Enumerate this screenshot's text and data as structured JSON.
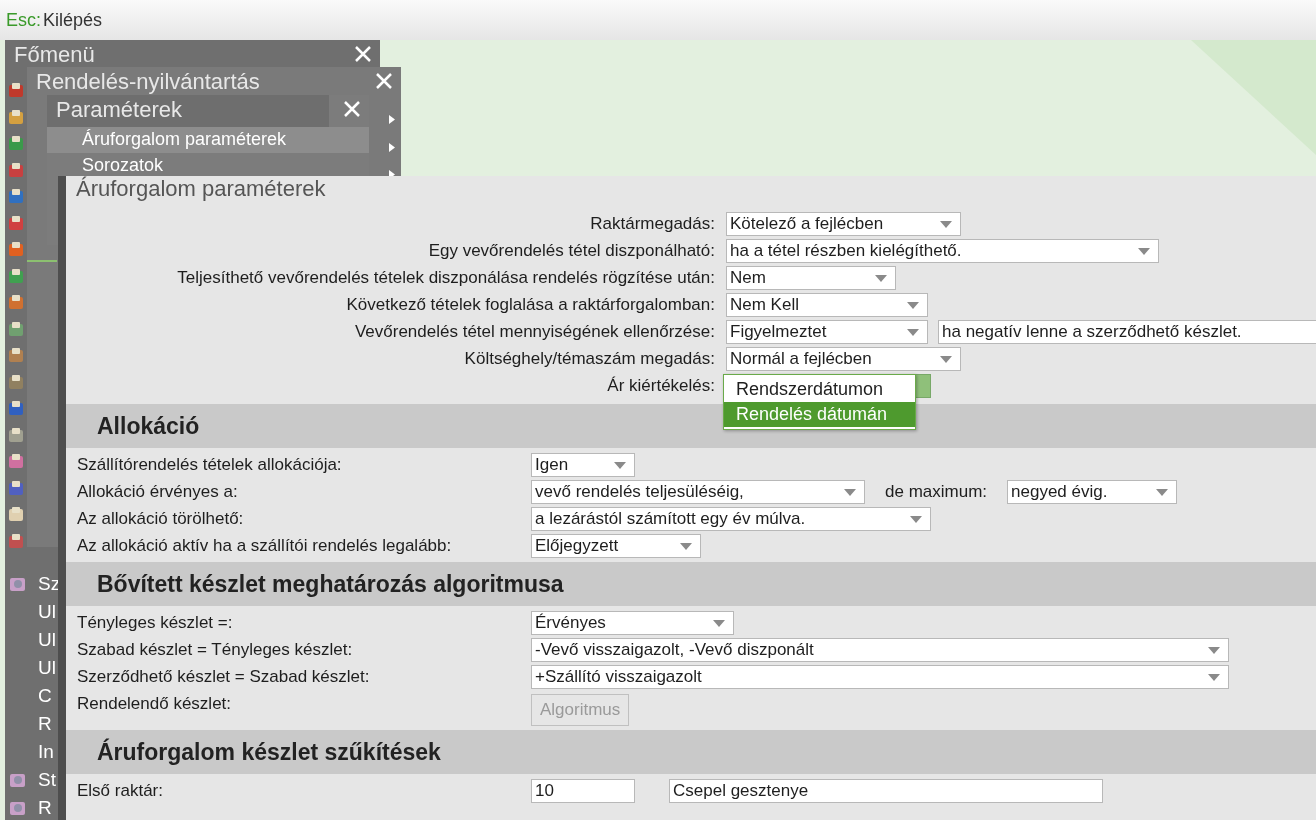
{
  "top_bar": {
    "key": "Esc:",
    "label": "Kilépés"
  },
  "main_menu": {
    "title": "Főmenü",
    "items": [
      {
        "label": "Sz",
        "kind": "icon"
      },
      {
        "label": "Ul",
        "kind": "text"
      },
      {
        "label": "Ul",
        "kind": "text"
      },
      {
        "label": "Ul",
        "kind": "text"
      },
      {
        "label": "C",
        "kind": "text"
      },
      {
        "label": "R",
        "kind": "text"
      },
      {
        "label": "In",
        "kind": "text"
      },
      {
        "label": "St",
        "kind": "icon"
      },
      {
        "label": "R",
        "kind": "icon"
      }
    ]
  },
  "order_window": {
    "title": "Rendelés-nyilvántartás"
  },
  "params_window": {
    "title": "Paraméterek",
    "items": [
      {
        "label": "Áruforgalom paraméterek",
        "selected": true
      },
      {
        "label": "Sorozatok",
        "selected": false
      }
    ]
  },
  "dialog": {
    "title": "Áruforgalom paraméterek",
    "top_rows": [
      {
        "label": "Raktármegadás:",
        "kind": "select",
        "value": "Kötelező a fejlécben"
      },
      {
        "label": "Egy vevőrendelés tétel diszponálható:",
        "kind": "select",
        "value": "ha a tétel részben kielégíthető."
      },
      {
        "label": "Teljesíthető vevőrendelés tételek diszponálása rendelés rögzítése után:",
        "kind": "select",
        "value": "Nem"
      },
      {
        "label": "Következő tételek foglalása a raktárforgalomban:",
        "kind": "select",
        "value": "Nem Kell"
      },
      {
        "label": "Vevőrendelés tétel mennyiségének ellenőrzése:",
        "kind": "select",
        "value": "Figyelmeztet",
        "extra": "ha negatív lenne a szerződhető készlet."
      },
      {
        "label": "Költséghely/témaszám megadás:",
        "kind": "select",
        "value": "Normál a fejlécben"
      },
      {
        "label": "Ár kiértékelés:",
        "kind": "open_select",
        "options": [
          {
            "label": "Rendszerdátumon",
            "selected": false
          },
          {
            "label": "Rendelés dátumán",
            "selected": true
          }
        ]
      }
    ],
    "sections": [
      {
        "title": "Allokáció",
        "rows": [
          {
            "label": "Szállítórendelés tételek allokációja:",
            "kind": "select",
            "value": "Igen"
          },
          {
            "label": "Allokáció érvényes a:",
            "kind": "select",
            "value": "vevő rendelés teljesüléséig,",
            "extra_label": "de maximum:",
            "extra_value": "negyed évig."
          },
          {
            "label": "Az allokáció törölhető:",
            "kind": "select",
            "value": "a lezárástól számított egy év múlva."
          },
          {
            "label": "Az allokáció aktív ha a szállítói rendelés legalább:",
            "kind": "select",
            "value": "Előjegyzett"
          }
        ]
      },
      {
        "title": "Bővített készlet meghatározás algoritmusa",
        "rows": [
          {
            "label": "Tényleges készlet =:",
            "kind": "select",
            "value": "Érvényes"
          },
          {
            "label": "Szabad készlet = Tényleges készlet:",
            "kind": "select",
            "value": "-Vevő visszaigazolt, -Vevő diszponált"
          },
          {
            "label": "Szerződhető készlet = Szabad készlet:",
            "kind": "select",
            "value": "+Szállító visszaigazolt"
          },
          {
            "label": "Rendelendő készlet:",
            "kind": "button",
            "value": "Algoritmus",
            "disabled": true
          }
        ]
      },
      {
        "title": "Áruforgalom készlet szűkítések",
        "rows": [
          {
            "label": "Első raktár:",
            "kind": "text",
            "value": "10",
            "extra": "Csepel gesztenye"
          }
        ]
      }
    ]
  }
}
